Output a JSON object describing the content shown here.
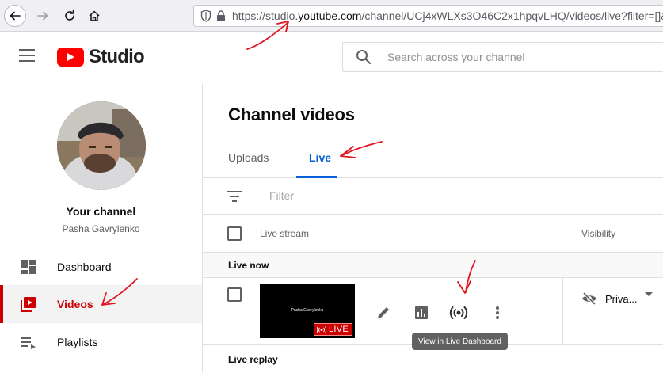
{
  "browser": {
    "url_prefix": "https://studio.",
    "url_host": "youtube.com",
    "url_path": "/channel/UCj4xWLXs3O46C2x1hpqvLHQ/videos/live?filter=[]&sc"
  },
  "header": {
    "logo_text": "Studio",
    "search_placeholder": "Search across your channel"
  },
  "sidebar": {
    "channel_label": "Your channel",
    "channel_name": "Pasha Gavrylenko",
    "items": [
      {
        "label": "Dashboard",
        "icon": "dashboard-icon"
      },
      {
        "label": "Videos",
        "icon": "videos-icon",
        "active": true
      },
      {
        "label": "Playlists",
        "icon": "playlists-icon"
      }
    ]
  },
  "main": {
    "title": "Channel videos",
    "tabs": [
      {
        "label": "Uploads"
      },
      {
        "label": "Live",
        "selected": true
      }
    ],
    "filter_placeholder": "Filter",
    "columns": {
      "live_stream": "Live stream",
      "visibility": "Visibility"
    },
    "sections": {
      "live_now": "Live now",
      "live_replay": "Live replay"
    },
    "video": {
      "thumbnail_text": "Pasha Gavrylenko",
      "badge": "LIVE",
      "visibility": "Priva...",
      "tooltip": "View in Live Dashboard"
    }
  },
  "colors": {
    "brand_red": "#ff0000",
    "active_red": "#cc0000",
    "tab_blue": "#065fd4",
    "annotation_red": "#e3151f"
  }
}
